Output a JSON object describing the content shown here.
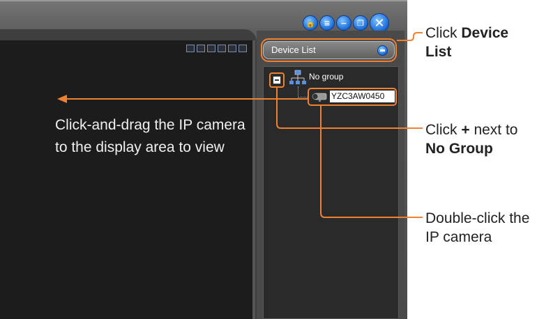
{
  "device_panel": {
    "title": "Device List",
    "tree": {
      "group_label": "No group",
      "camera_label": "YZC3AW0450"
    }
  },
  "display": {
    "instruction": "Click-and-drag the IP camera to the display area to view"
  },
  "annotations": {
    "device_list": {
      "prefix": "Click ",
      "bold": "Device List"
    },
    "no_group": {
      "prefix": "Click ",
      "bold_plus": "+",
      "middle": " next to ",
      "bold": "No Group"
    },
    "camera": {
      "text": "Double-click the IP camera"
    }
  },
  "colors": {
    "accent": "#f0812f",
    "window_button": "#1a6ad8"
  },
  "icons": [
    "lock-icon",
    "menu-icon",
    "minimize-icon",
    "restore-icon",
    "close-icon",
    "network-group-icon",
    "camera-icon"
  ]
}
